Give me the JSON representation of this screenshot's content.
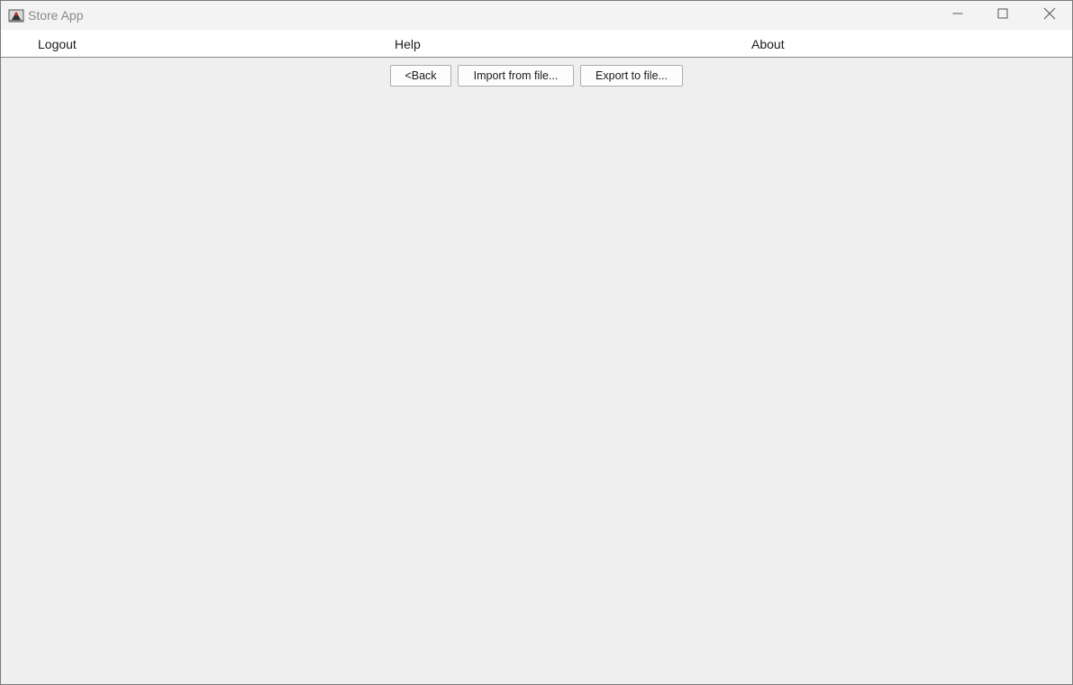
{
  "window": {
    "title": "Store App",
    "icons": {
      "app": "java-duke-icon",
      "minimize": "minimize-icon",
      "maximize": "maximize-icon",
      "close": "close-icon"
    }
  },
  "menubar": {
    "items": [
      {
        "label": "Logout"
      },
      {
        "label": "Help"
      },
      {
        "label": "About"
      }
    ]
  },
  "toolbar": {
    "back_label": "<Back",
    "import_label": "Import from file...",
    "export_label": "Export to file..."
  },
  "colors": {
    "content_background": "#efefef",
    "titlebar_background": "#f3f3f3",
    "menubar_background": "#ffffff",
    "button_background": "#fdfdfd",
    "button_border": "#adadad"
  }
}
